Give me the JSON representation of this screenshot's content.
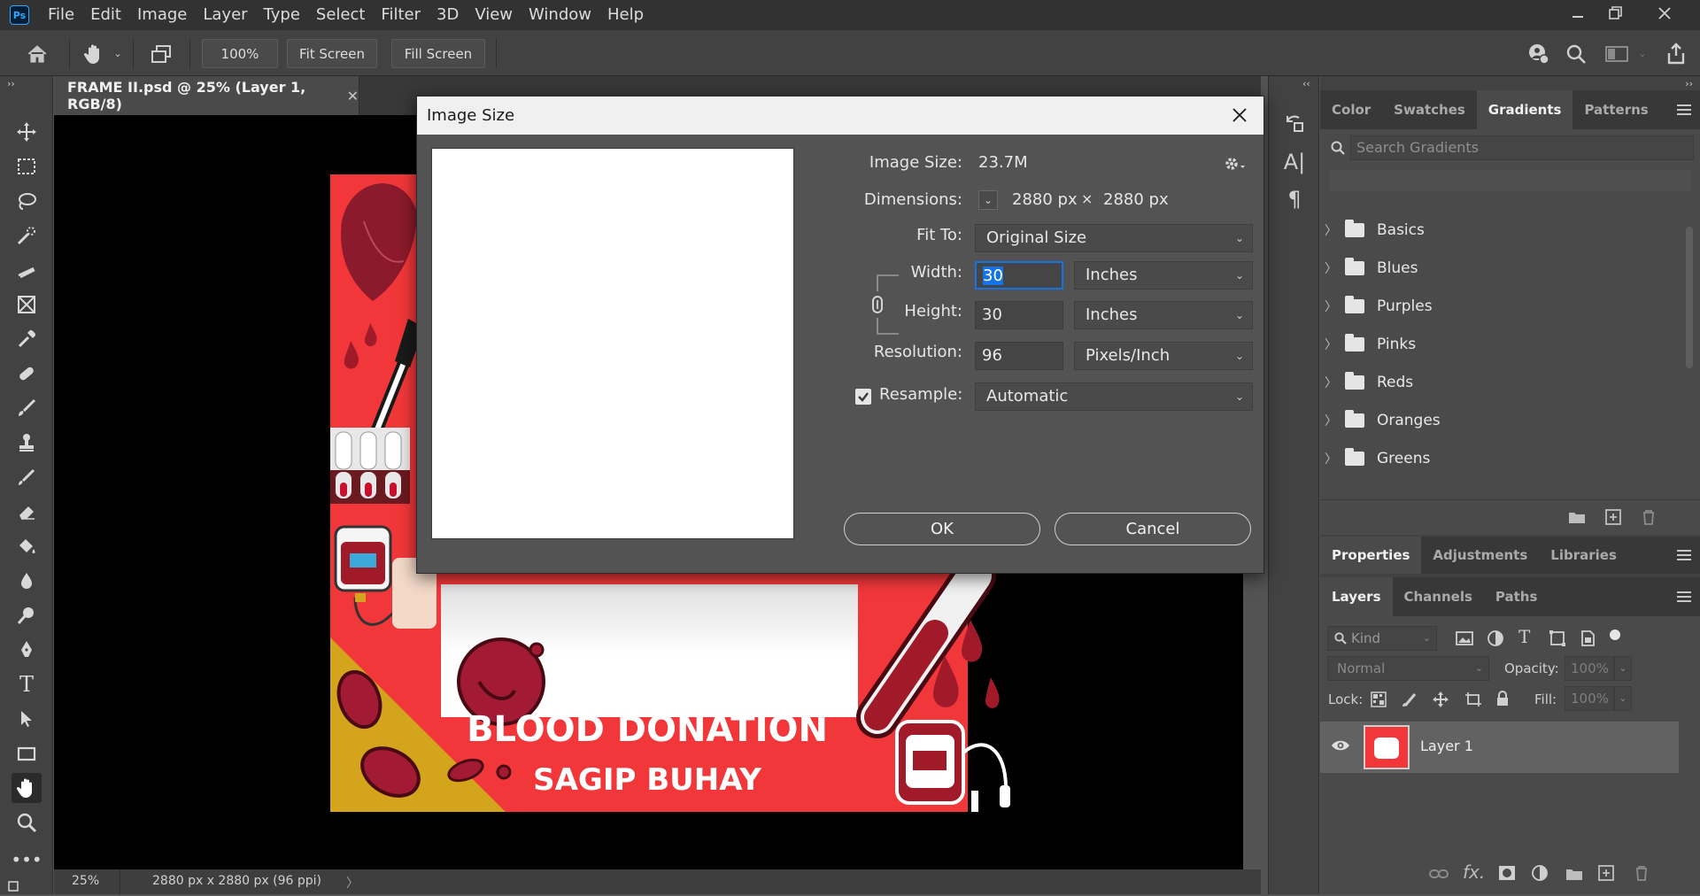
{
  "app": {
    "logo": "Ps"
  },
  "menu": [
    "File",
    "Edit",
    "Image",
    "Layer",
    "Type",
    "Select",
    "Filter",
    "3D",
    "View",
    "Window",
    "Help"
  ],
  "options_bar": {
    "zoom": "100%",
    "fit_screen": "Fit Screen",
    "fill_screen": "Fill Screen"
  },
  "document": {
    "tab_title": "FRAME II.psd @ 25% (Layer 1, RGB/8)",
    "canvas_text_1": "BLOOD DONATION",
    "canvas_text_2": "SAGIP BUHAY",
    "status_zoom": "25%",
    "status_info": "2880 px x 2880 px (96 ppi)"
  },
  "dialog": {
    "title": "Image Size",
    "image_size_label": "Image Size:",
    "image_size_value": "23.7M",
    "dimensions_label": "Dimensions:",
    "dim_w": "2880 px",
    "dim_x": "×",
    "dim_h": "2880 px",
    "fit_to_label": "Fit To:",
    "fit_to_value": "Original Size",
    "width_label": "Width:",
    "width_value": "30",
    "width_unit": "Inches",
    "height_label": "Height:",
    "height_value": "30",
    "height_unit": "Inches",
    "resolution_label": "Resolution:",
    "resolution_value": "96",
    "resolution_unit": "Pixels/Inch",
    "resample_label": "Resample:",
    "resample_value": "Automatic",
    "ok": "OK",
    "cancel": "Cancel"
  },
  "gradients_panel": {
    "tabs": [
      "Color",
      "Swatches",
      "Gradients",
      "Patterns"
    ],
    "active_tab": "Gradients",
    "search_placeholder": "Search Gradients",
    "folders": [
      "Basics",
      "Blues",
      "Purples",
      "Pinks",
      "Reds",
      "Oranges",
      "Greens"
    ]
  },
  "properties_tabs": [
    "Properties",
    "Adjustments",
    "Libraries"
  ],
  "layers_panel": {
    "tabs": [
      "Layers",
      "Channels",
      "Paths"
    ],
    "kind": "Kind",
    "blend_mode": "Normal",
    "opacity_label": "Opacity:",
    "opacity_value": "100%",
    "lock_label": "Lock:",
    "fill_label": "Fill:",
    "fill_value": "100%",
    "layer_name": "Layer 1"
  },
  "colors": {
    "accent_blue": "#1473e6",
    "canvas_red": "#f2373a",
    "dark_red": "#a01a2a",
    "mustard": "#d4a51c"
  }
}
